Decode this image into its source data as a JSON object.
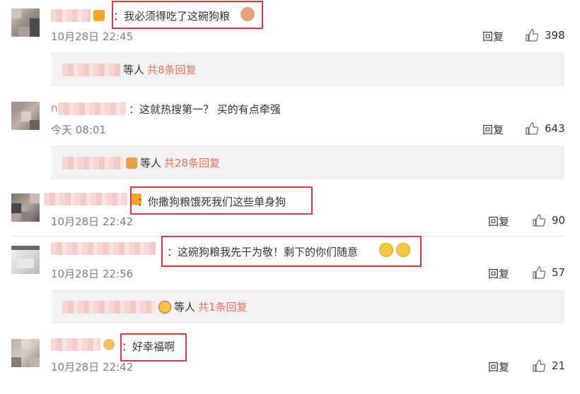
{
  "comments": [
    {
      "text": "：我必须得吃了这碗狗粮",
      "time": "10月28日 22:45",
      "reply": "回复",
      "likes": "398",
      "sub": {
        "suffix": "等人",
        "count": "共8条回复"
      }
    },
    {
      "name_visible": "n",
      "text": "：这就热搜第一？ 买的有点牵强",
      "time": "今天 08:01",
      "reply": "回复",
      "likes": "643",
      "sub": {
        "suffix": "等人",
        "count": "共28条回复"
      }
    },
    {
      "text": "：你撒狗粮饿死我们这些单身狗",
      "time": "10月28日 22:42",
      "reply": "回复",
      "likes": "90"
    },
    {
      "text": "：这碗狗粮我先干为敬！剩下的你们随意",
      "time": "10月28日 22:56",
      "reply": "回复",
      "likes": "57",
      "sub": {
        "suffix": "等人",
        "count": "共1条回复"
      }
    },
    {
      "text": "：好幸福啊",
      "time": "10月28日 22:42",
      "reply": "回复",
      "likes": "21"
    }
  ],
  "colors": {
    "accent": "#eb7350",
    "highlight_border": "#e5373e",
    "subbox_bg": "#f2f2f5"
  },
  "icons": {
    "like": "thumbs-up-icon",
    "crying": "crying-emoji-icon",
    "badge": "member-badge-icon"
  }
}
